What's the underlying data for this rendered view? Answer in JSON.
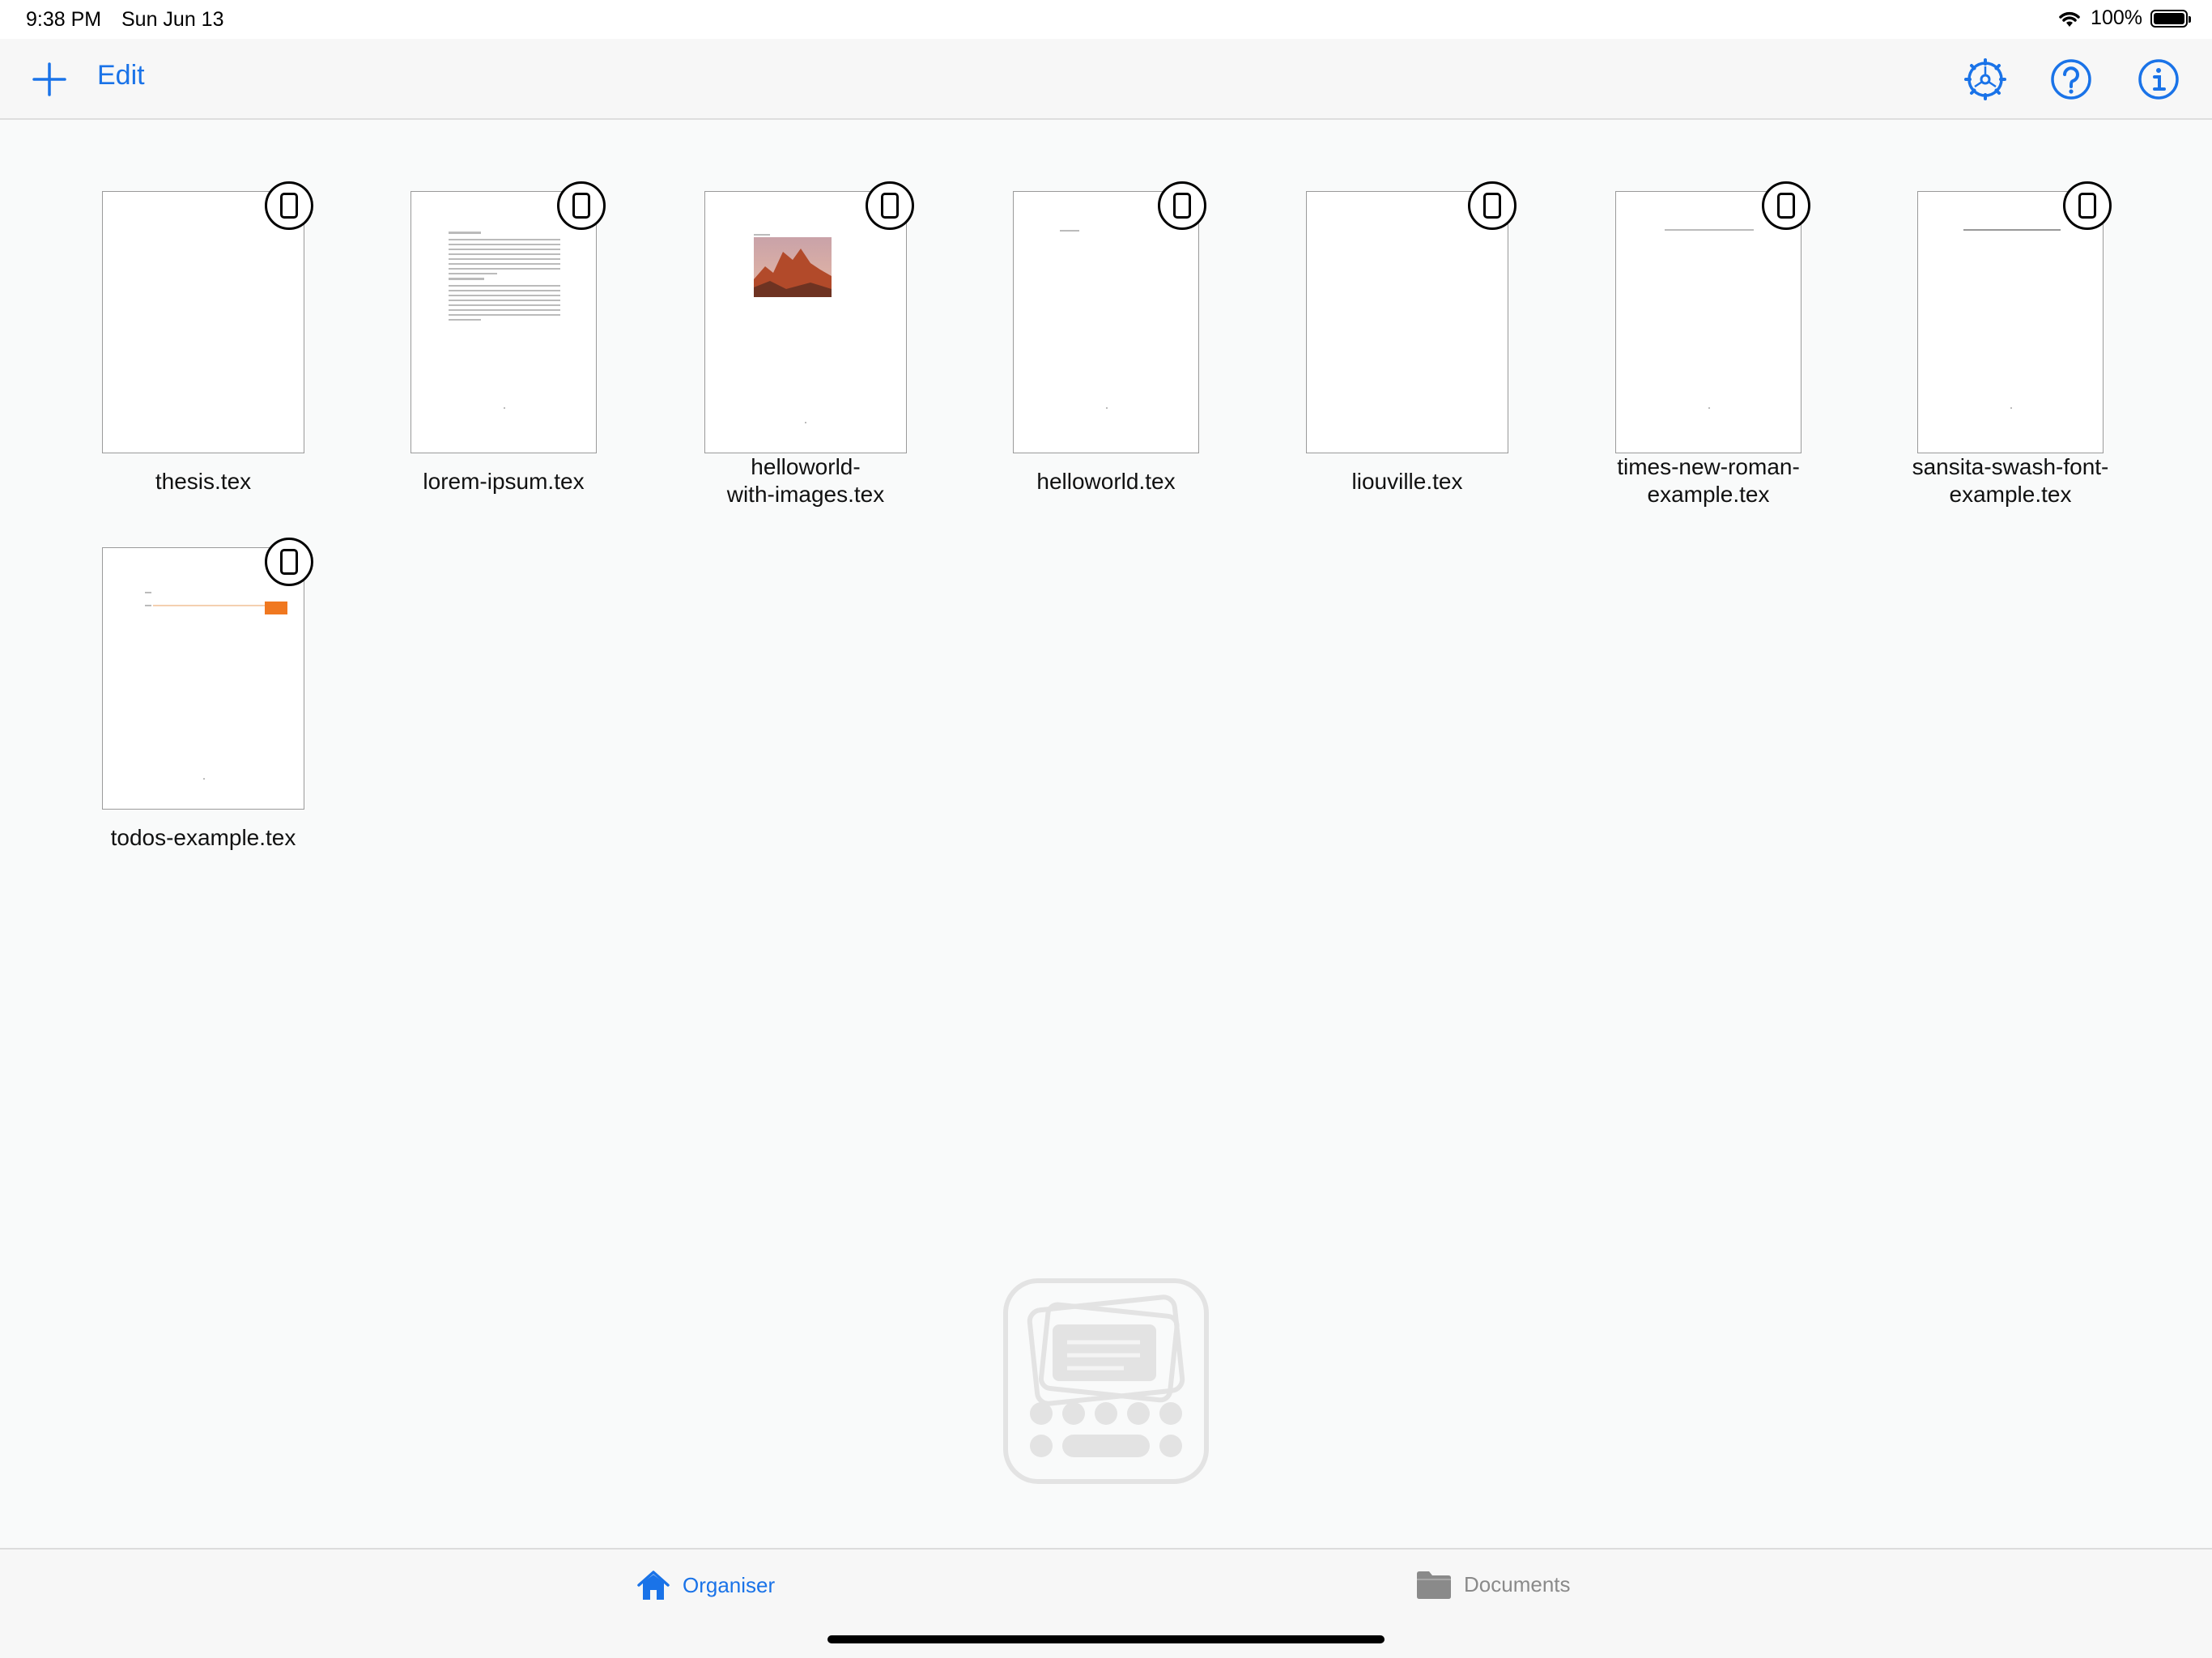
{
  "status_bar": {
    "time": "9:38 PM",
    "date": "Sun Jun 13",
    "battery": "100%"
  },
  "toolbar": {
    "edit_label": "Edit",
    "icons": [
      "plus-icon",
      "settings-gear-icon",
      "help-icon",
      "info-icon"
    ],
    "accent_color": "#1a73e8"
  },
  "files": [
    {
      "name": "thesis.tex"
    },
    {
      "name": "lorem-ipsum.tex"
    },
    {
      "name": "helloworld-with-images.tex"
    },
    {
      "name": "helloworld.tex"
    },
    {
      "name": "liouville.tex"
    },
    {
      "name": "times-new-roman-example.tex"
    },
    {
      "name": "sansita-swash-font-example.tex"
    },
    {
      "name": "todos-example.tex"
    }
  ],
  "file_names_wrapped": [
    [
      "thesis.tex"
    ],
    [
      "lorem-ipsum.tex"
    ],
    [
      "helloworld-",
      "with-images.tex"
    ],
    [
      "helloworld.tex"
    ],
    [
      "liouville.tex"
    ],
    [
      "times-new-roman-",
      "example.tex"
    ],
    [
      "sansita-swash-font-",
      "example.tex"
    ],
    [
      "todos-example.tex"
    ]
  ],
  "tab_bar": {
    "organiser_label": "Organiser",
    "documents_label": "Documents"
  }
}
